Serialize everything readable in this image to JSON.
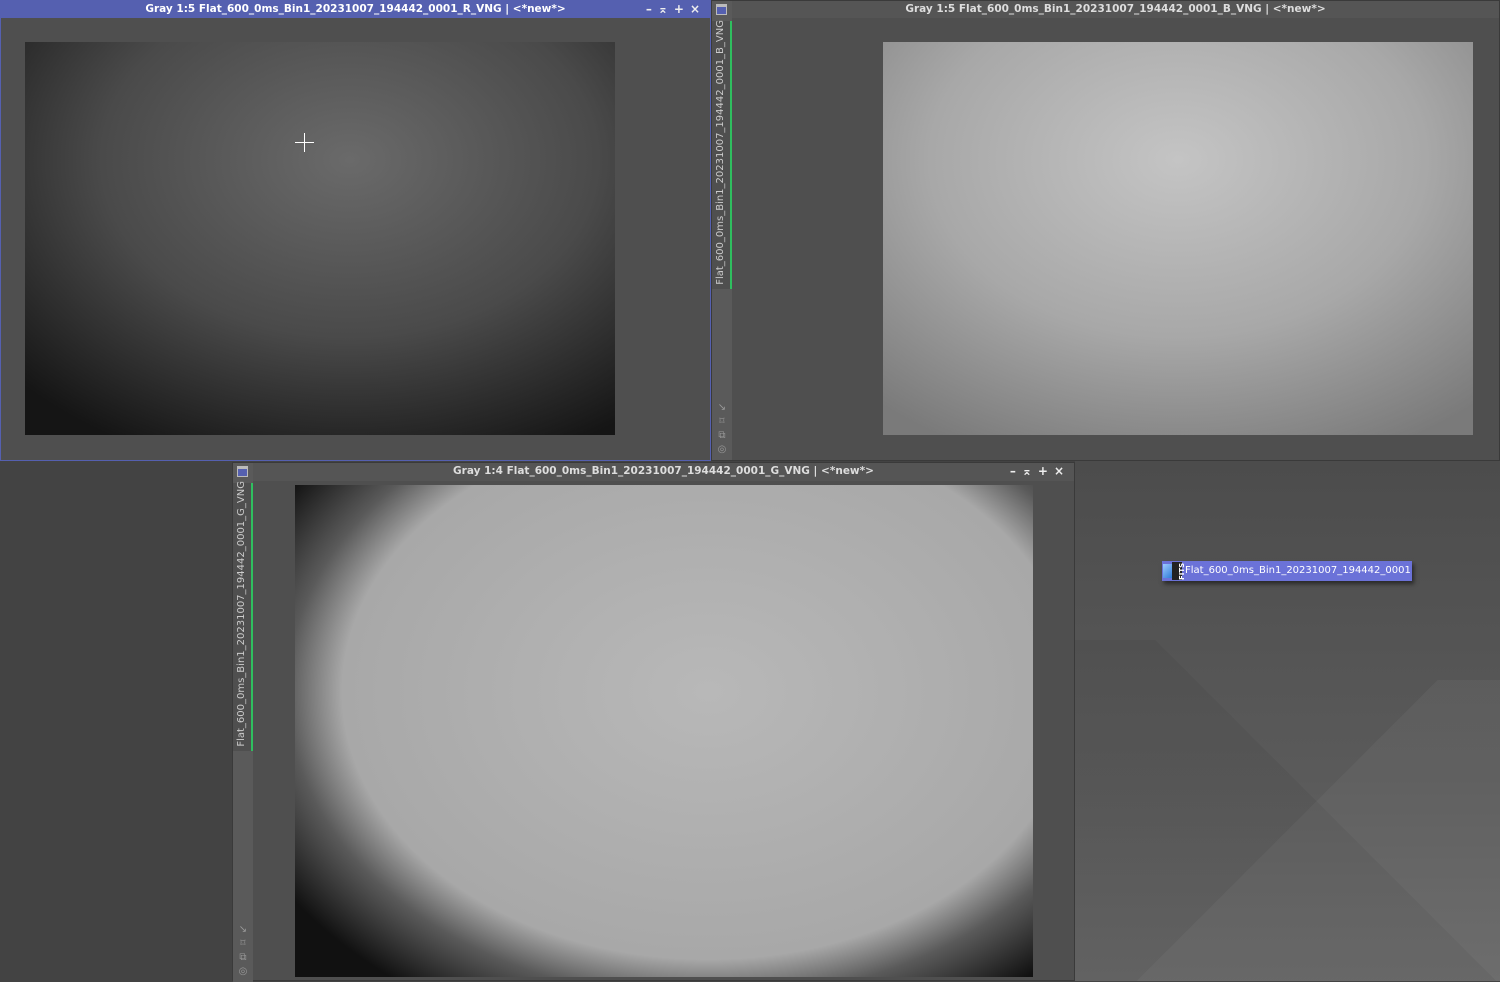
{
  "windows": {
    "red": {
      "title": "Gray 1:5 Flat_600_0ms_Bin1_20231007_194442_0001_R_VNG | <*new*>",
      "controls": "–⌅+×",
      "active": true
    },
    "blue": {
      "title": "Gray 1:5 Flat_600_0ms_Bin1_20231007_194442_0001_B_VNG | <*new*>",
      "side_label": "Flat_600_0ms_Bin1_20231007_194442_0001_B_VNG"
    },
    "green": {
      "title": "Gray 1:4 Flat_600_0ms_Bin1_20231007_194442_0001_G_VNG | <*new*>",
      "controls": "–⌅+×",
      "side_label": "Flat_600_0ms_Bin1_20231007_194442_0001_G_VNG"
    }
  },
  "side_icons": [
    "↘",
    "⌑",
    "⧉",
    "◎"
  ],
  "desktop_icon": {
    "label": "Flat_600_0ms_Bin1_20231007_194442_0001",
    "badge": "FITS"
  },
  "colors": {
    "active_title": "#5560b0",
    "side_tab_accent": "#2fbf5f"
  }
}
